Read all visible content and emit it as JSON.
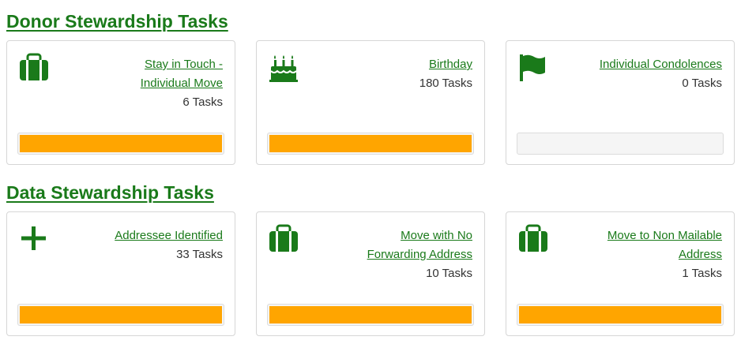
{
  "colors": {
    "green": "#1a7a1a",
    "bar": "#ffa500",
    "track": "#f5f5f5"
  },
  "sections": [
    {
      "title": "Donor Stewardship Tasks",
      "cards": [
        {
          "icon": "suitcase-icon",
          "title_lines": [
            "Stay in Touch -",
            "Individual Move"
          ],
          "count": "6 Tasks",
          "progress": 1.0
        },
        {
          "icon": "birthday-cake-icon",
          "title_lines": [
            "Birthday"
          ],
          "count": "180 Tasks",
          "progress": 1.0
        },
        {
          "icon": "flag-icon",
          "title_lines": [
            "Individual Condolences"
          ],
          "count": "0 Tasks",
          "progress": 0.0
        }
      ]
    },
    {
      "title": "Data Stewardship Tasks",
      "cards": [
        {
          "icon": "plus-icon",
          "title_lines": [
            "Addressee Identified"
          ],
          "count": "33 Tasks",
          "progress": 1.0
        },
        {
          "icon": "suitcase-icon",
          "title_lines": [
            "Move with No",
            "Forwarding Address"
          ],
          "count": "10 Tasks",
          "progress": 1.0
        },
        {
          "icon": "suitcase-icon",
          "title_lines": [
            "Move to Non Mailable",
            "Address"
          ],
          "count": "1 Tasks",
          "progress": 1.0
        }
      ]
    }
  ]
}
